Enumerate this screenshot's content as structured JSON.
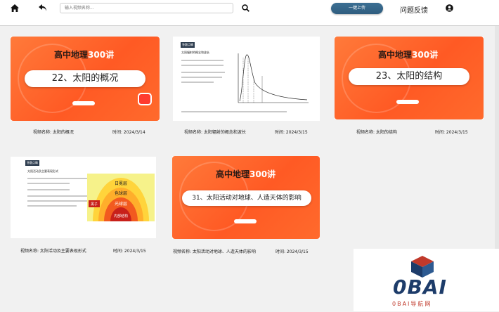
{
  "header": {
    "search_placeholder": "输入视频名称...",
    "upload_label": "一键上传",
    "feedback_label": "问题反馈"
  },
  "icons": {
    "home": "home-icon",
    "back": "back-arrow-icon",
    "search": "search-icon",
    "user": "user-icon"
  },
  "colors": {
    "accent_blue": "#2f5d7f",
    "thumb_orange": "#ff5a24"
  },
  "videos": [
    {
      "name_label": "视频名称: 太阳的概况",
      "time_label": "时间: 2024/3/14",
      "thumb_series": "高中地理",
      "thumb_count": "300讲",
      "thumb_title": "22、太阳的概况"
    },
    {
      "name_label": "视频名称: 太阳辐射的概念和波长",
      "time_label": "时间: 2024/3/15",
      "doc_tag": "答题点睛",
      "doc_title": "太阳辐射的概念和波长"
    },
    {
      "name_label": "视频名称: 太阳的结构",
      "time_label": "时间: 2024/3/15",
      "thumb_series": "高中地理",
      "thumb_count": "300讲",
      "thumb_title": "23、太阳的结构"
    },
    {
      "name_label": "视频名称: 太阳活动及主要表现形式",
      "time_label": "时间: 2024/3/15",
      "doc_tag": "答题点睛",
      "doc_title": "太阳活动及主要表现形式",
      "layers": [
        "日冕层",
        "色球层",
        "光球层",
        "黑子",
        "内部结构"
      ]
    },
    {
      "name_label": "视频名称: 太阳活动对地球、人造天体的影响",
      "time_label": "时间: 2024/3/15",
      "thumb_series": "高中地理",
      "thumb_count": "300讲",
      "thumb_title": "31、太阳活动对地球、人造天体的影响"
    }
  ],
  "watermark": {
    "brand": "0BAI",
    "sub": "0BAI导航网"
  }
}
